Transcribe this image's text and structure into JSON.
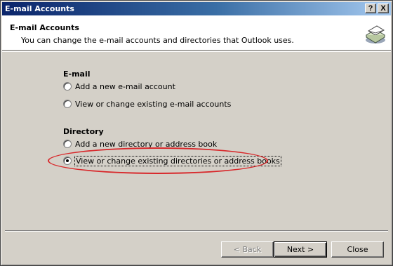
{
  "window": {
    "title": "E-mail Accounts",
    "help_button": "?",
    "close_button": "X"
  },
  "header": {
    "title": "E-mail Accounts",
    "subtitle": "You can change the e-mail accounts and directories that Outlook uses."
  },
  "email_group": {
    "label": "E-mail",
    "options": [
      {
        "label": "Add a new e-mail account",
        "checked": false
      },
      {
        "label": "View or change existing e-mail accounts",
        "checked": false
      }
    ]
  },
  "directory_group": {
    "label": "Directory",
    "options": [
      {
        "label": "Add a new directory or address book",
        "checked": false
      },
      {
        "label": "View or change existing directories or address books",
        "checked": true
      }
    ]
  },
  "buttons": {
    "back": "< Back",
    "next": "Next >",
    "close": "Close"
  },
  "colors": {
    "title_bar": "#0a246a",
    "dialog_face": "#d4d0c8",
    "annotation": "#d8282b"
  }
}
